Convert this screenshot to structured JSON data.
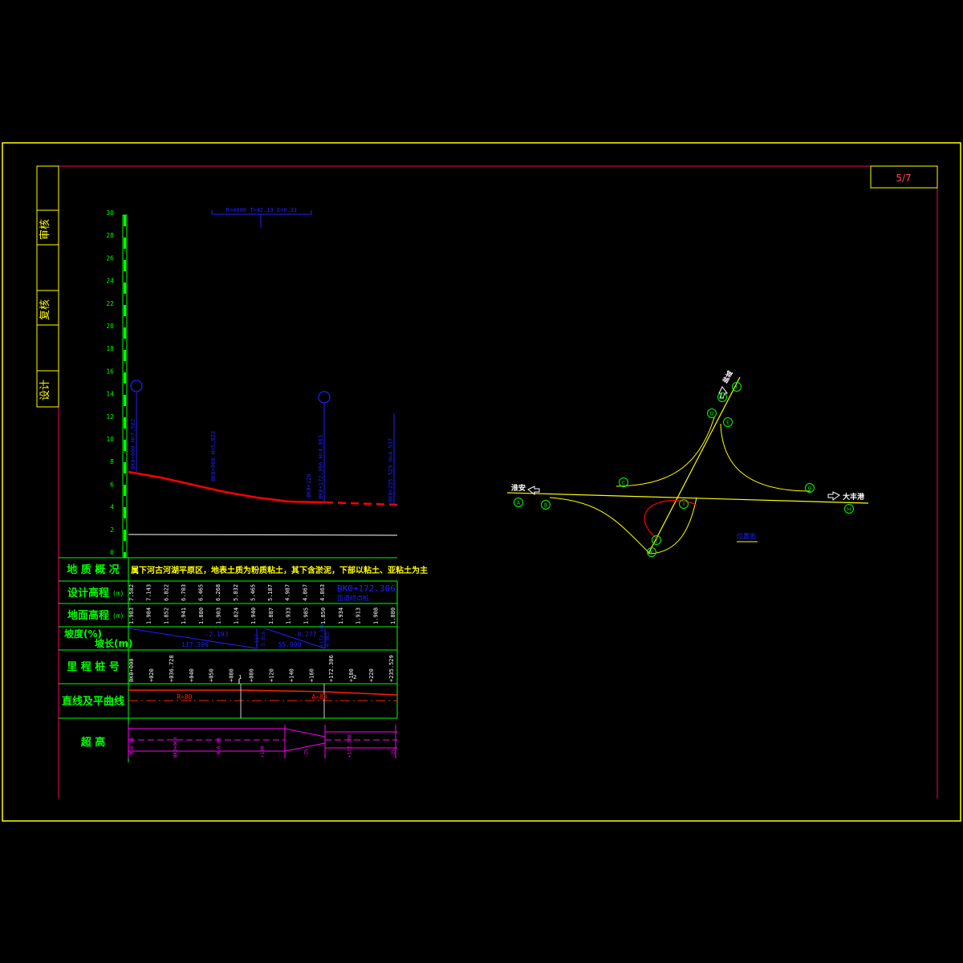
{
  "sheet": {
    "page_number": "5/7",
    "sign_labels": [
      "审核",
      "复核",
      "设计"
    ]
  },
  "profile": {
    "y_axis_ticks": [
      "0",
      "2",
      "4",
      "6",
      "8",
      "10",
      "12",
      "14",
      "16",
      "18",
      "20",
      "22",
      "24",
      "26",
      "28",
      "30"
    ],
    "vertical_curve_label": "R=4800 T=42.13 E=0.31",
    "annotations": {
      "a1": "BK0+000 H=7.582",
      "a2": "BK0+060 H=5.822",
      "a3": "BK0+120",
      "a4": "BK0+172.306 H=4.863",
      "a5": "BK0+235.529 H=4.537"
    },
    "table": {
      "geology_label": "地 质 概 况",
      "geology_text": "属下河古河湖平原区，地表土质为粉质粘土，其下含淤泥，下部以粘土、亚粘土为主",
      "design_elev_label": "设计高程",
      "ground_elev_label": "地面高程",
      "unit_m": "(m)",
      "design_elev": [
        "7.582",
        "7.143",
        "6.822",
        "6.703",
        "6.465",
        "6.268",
        "5.832",
        "5.465",
        "5.187",
        "4.987",
        "4.867",
        "4.863"
      ],
      "ground_elev": [
        "1.983",
        "1.984",
        "1.852",
        "1.941",
        "1.880",
        "1.903",
        "1.824",
        "1.940",
        "1.887",
        "1.933",
        "1.985",
        "1.850",
        "1.934",
        "1.913",
        "1.908",
        "1.880"
      ],
      "design_note_main": "BK0+172.306",
      "design_note_sub": "匝道终点桩",
      "slope_label": "坡度(%)",
      "slope_len_label": "坡长(m)",
      "slope1": "-2.193",
      "len1": "117.306",
      "slope2": "-0.277",
      "len2": "55.000",
      "slope_mid_a": "+117",
      "slope_mid_b": "5.016",
      "slope_mid_c": "+172.306",
      "slope_mid_d": "4.863",
      "chainage_label": "里 程 桩 号",
      "chainages": [
        "BK0+000",
        "+020",
        "+036.728",
        "+040",
        "+050",
        "+080",
        "+080",
        "+120",
        "+140",
        "+160",
        "+172.306",
        "+180",
        "+220",
        "+235.529"
      ],
      "chainage_marker1": "1",
      "chainage_marker2": "2",
      "alignment_label": "直线及平曲线",
      "curve_r": "R=80",
      "curve_a": "A=80",
      "super_label": "超 高",
      "super_vals": [
        "-0.6 0%",
        "BK0+000",
        "-0.6 0%",
        "+100",
        "-2%",
        "+172.306",
        "-2%"
      ]
    }
  },
  "plan": {
    "city_left": "淮安",
    "city_right": "大丰港",
    "north_label": "盐城",
    "caption": "位置图",
    "node_labels": [
      "A",
      "B",
      "C",
      "D",
      "E",
      "F",
      "G",
      "H",
      "I",
      "J",
      "K",
      "M"
    ]
  },
  "colors": {
    "frame_yellow": "#ffff00",
    "frame_magenta": "#ff0060",
    "grid_green": "#00ff00",
    "text_blue": "#2020ff",
    "profile_red": "#ff0000",
    "super_magenta": "#ff00ff"
  }
}
